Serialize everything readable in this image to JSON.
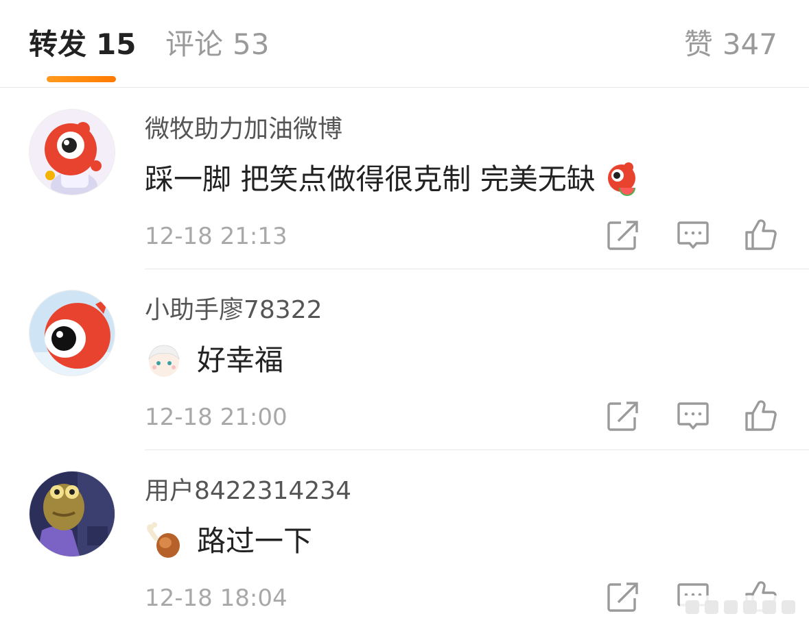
{
  "tabs": {
    "repost": {
      "label": "转发",
      "count": "15"
    },
    "comment": {
      "label": "评论",
      "count": "53"
    },
    "likes": {
      "label": "赞",
      "count": "347"
    },
    "active": "repost",
    "accent_color": "#ff8200"
  },
  "comments": [
    {
      "username": "微牧助力加油微博",
      "text": "踩一脚 把笑点做得很克制 完美无缺",
      "emoji": "red-mascot-watermelon-emoji",
      "avatar": "red-mascot-avatar",
      "timestamp": "12-18 21:13"
    },
    {
      "username": "小助手廖78322",
      "text": "好幸福",
      "emoji": "cartoon-boy-face-emoji",
      "avatar": "red-eye-mascot-avatar",
      "timestamp": "12-18 21:00"
    },
    {
      "username": "用户8422314234",
      "text": "路过一下",
      "emoji": "chicken-drumstick-emoji",
      "avatar": "cartoon-fish-avatar",
      "timestamp": "12-18 18:04"
    }
  ],
  "actions": {
    "repost_icon": "repost-icon",
    "comment_icon": "comment-icon",
    "like_icon": "thumbs-up-icon",
    "icon_color": "#9a9a9a"
  }
}
